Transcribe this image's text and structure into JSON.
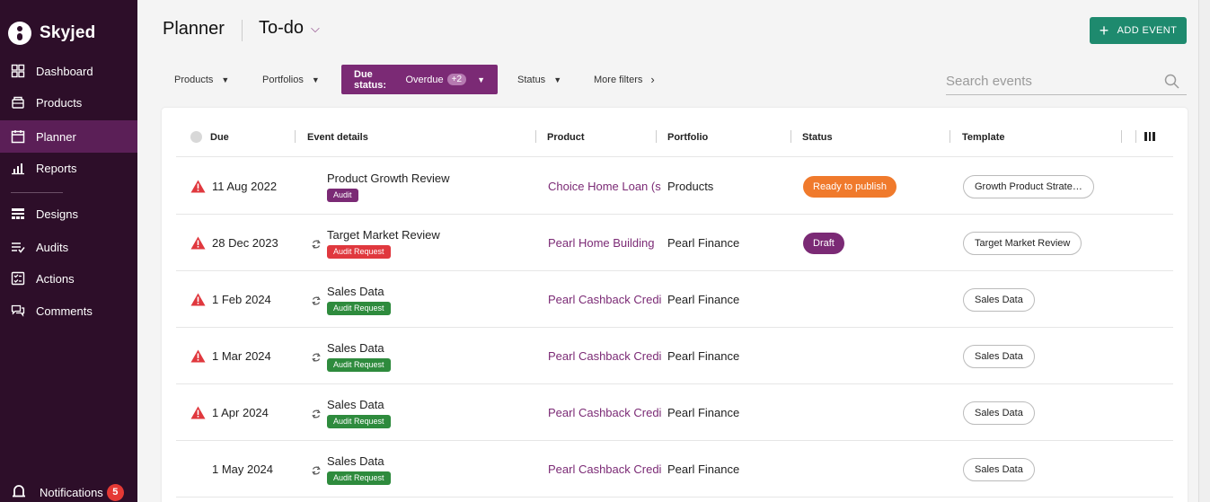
{
  "brand": {
    "name": "Skyjed"
  },
  "sidebar": {
    "items": [
      {
        "label": "Dashboard",
        "icon": "dashboard-icon"
      },
      {
        "label": "Products",
        "icon": "products-icon"
      },
      {
        "label": "Planner",
        "icon": "calendar-icon",
        "active": true
      },
      {
        "label": "Reports",
        "icon": "reports-icon"
      },
      {
        "label": "Designs",
        "icon": "designs-icon"
      },
      {
        "label": "Audits",
        "icon": "audits-icon"
      },
      {
        "label": "Actions",
        "icon": "actions-icon"
      },
      {
        "label": "Comments",
        "icon": "comments-icon"
      }
    ],
    "notifications": {
      "label": "Notifications",
      "count": "5"
    }
  },
  "header": {
    "title": "Planner",
    "view": "To-do",
    "add_button": "ADD EVENT"
  },
  "filters": {
    "products": "Products",
    "portfolios": "Portfolios",
    "due_status_label": "Due status:",
    "due_status_value": "Overdue",
    "due_status_extra": "+2",
    "status": "Status",
    "more": "More filters",
    "search_placeholder": "Search events"
  },
  "table": {
    "columns": {
      "due": "Due",
      "details": "Event details",
      "product": "Product",
      "portfolio": "Portfolio",
      "status": "Status",
      "template": "Template"
    },
    "rows": [
      {
        "due": "11 Aug 2022",
        "overdue": true,
        "recurring": false,
        "event": "Product Growth Review",
        "tag": "Audit",
        "tag_color": "purple",
        "product": "Choice Home Loan (s",
        "portfolio": "Products",
        "status": "Ready to publish",
        "status_color": "orange",
        "template": "Growth Product Strate…"
      },
      {
        "due": "28 Dec 2023",
        "overdue": true,
        "recurring": true,
        "event": "Target Market Review",
        "tag": "Audit Request",
        "tag_color": "red",
        "product": "Pearl Home Building",
        "portfolio": "Pearl Finance",
        "status": "Draft",
        "status_color": "purple",
        "template": "Target Market Review"
      },
      {
        "due": "1 Feb 2024",
        "overdue": true,
        "recurring": true,
        "event": "Sales Data",
        "tag": "Audit Request",
        "tag_color": "green",
        "product": "Pearl Cashback Credi",
        "portfolio": "Pearl Finance",
        "status": "",
        "status_color": "",
        "template": "Sales Data"
      },
      {
        "due": "1 Mar 2024",
        "overdue": true,
        "recurring": true,
        "event": "Sales Data",
        "tag": "Audit Request",
        "tag_color": "green",
        "product": "Pearl Cashback Credi",
        "portfolio": "Pearl Finance",
        "status": "",
        "status_color": "",
        "template": "Sales Data"
      },
      {
        "due": "1 Apr 2024",
        "overdue": true,
        "recurring": true,
        "event": "Sales Data",
        "tag": "Audit Request",
        "tag_color": "green",
        "product": "Pearl Cashback Credi",
        "portfolio": "Pearl Finance",
        "status": "",
        "status_color": "",
        "template": "Sales Data"
      },
      {
        "due": "1 May 2024",
        "overdue": false,
        "recurring": true,
        "event": "Sales Data",
        "tag": "Audit Request",
        "tag_color": "green",
        "product": "Pearl Cashback Credi",
        "portfolio": "Pearl Finance",
        "status": "",
        "status_color": "",
        "template": "Sales Data"
      }
    ]
  },
  "colors": {
    "sidebar_bg": "#2d0e29",
    "accent": "#7b2a75",
    "primary_button": "#1e8a6e",
    "warning": "#e0383e",
    "tag_green": "#2e8b3d",
    "status_orange": "#f07a2c"
  }
}
